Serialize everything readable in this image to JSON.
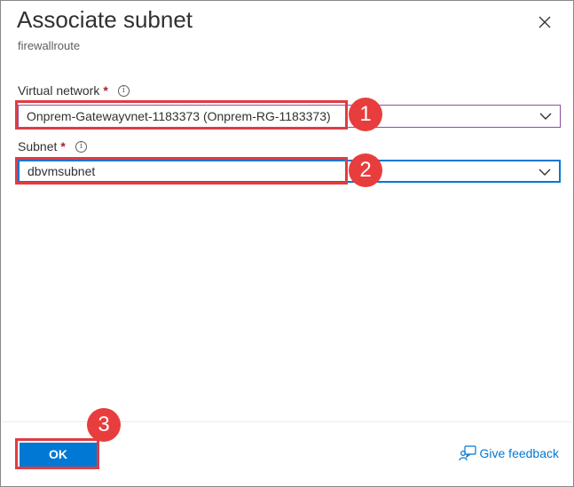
{
  "panel": {
    "title": "Associate subnet",
    "subtitle": "firewallroute"
  },
  "form": {
    "virtual_network": {
      "label": "Virtual network",
      "required_mark": "*",
      "info": "i",
      "value": "Onprem-Gatewayvnet-1183373 (Onprem-RG-1183373)"
    },
    "subnet": {
      "label": "Subnet",
      "required_mark": "*",
      "info": "i",
      "value": "dbvmsubnet"
    }
  },
  "footer": {
    "ok_label": "OK",
    "feedback_label": "Give feedback"
  },
  "callouts": [
    "1",
    "2",
    "3"
  ],
  "colors": {
    "accent": "#0078d4",
    "callout": "#e83d3d",
    "required": "#a4262c"
  }
}
